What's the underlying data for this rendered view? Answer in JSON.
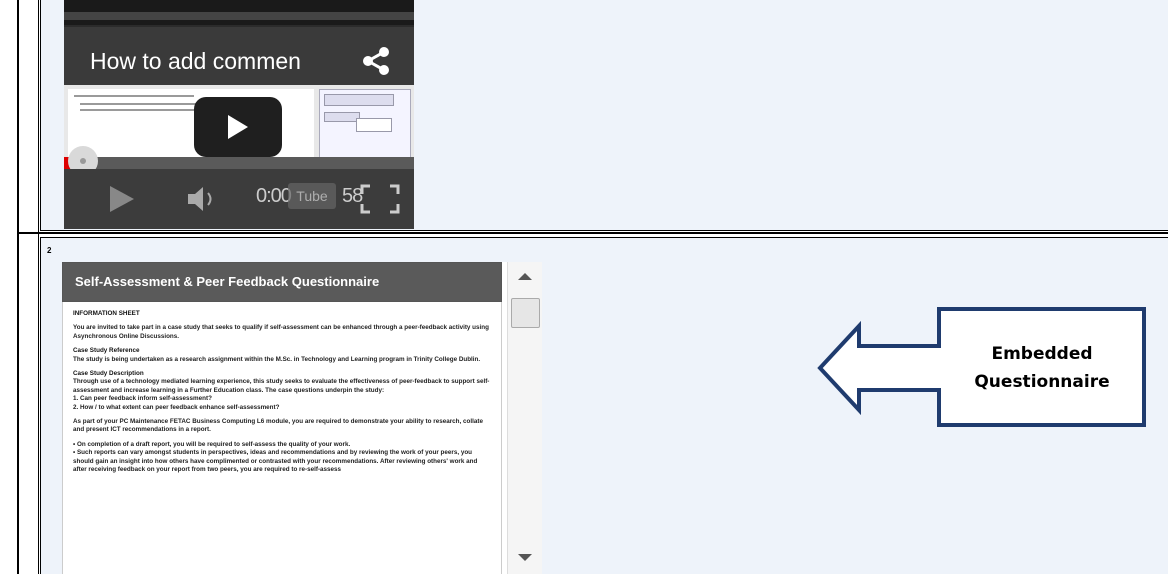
{
  "video": {
    "title": "How to add commen",
    "time_text": "0:00",
    "brand_text": "Tube",
    "duration_text": "58",
    "icons": [
      "share-icon",
      "play-icon",
      "volume-icon",
      "fullscreen-icon"
    ]
  },
  "row_marker": "2",
  "questionnaire": {
    "title": "Self-Assessment & Peer Feedback Questionnaire",
    "heading": "INFORMATION SHEET",
    "intro": "You are invited to take part in a case study that seeks to qualify if self-assessment can be enhanced through a peer-feedback activity using Asynchronous Online Discussions.",
    "ref_heading": "Case Study Reference",
    "ref_text": "The study is being undertaken as a research assignment within the M.Sc. in Technology and Learning program in Trinity College Dublin.",
    "desc_heading": "Case Study Description",
    "desc_text": "Through use of a technology mediated learning experience, this study seeks to evaluate the effectiveness of peer-feedback to support self-assessment and increase learning in a Further Education class. The case questions underpin the study:",
    "q1": "1.   Can peer feedback inform self-assessment?",
    "q2": "2.   How / to what extent can peer feedback enhance self-assessment?",
    "part_text": "As part of your PC Maintenance FETAC Business Computing L6 module, you are required to demonstrate your ability to research, collate and present ICT recommendations in a report.",
    "bullet1": "•    On completion of a draft report, you will be required to self-assess the quality of your work.",
    "bullet2": "•    Such reports can vary amongst students in perspectives, ideas and recommendations and by reviewing the work of your peers, you should gain an insight into how others have complimented or contrasted with your recommendations. After reviewing others' work and after receiving feedback on your report from two peers, you are required to re-self-assess"
  },
  "callout": {
    "line1": "Embedded",
    "line2": "Questionnaire",
    "border_color": "#1f3b6e"
  }
}
